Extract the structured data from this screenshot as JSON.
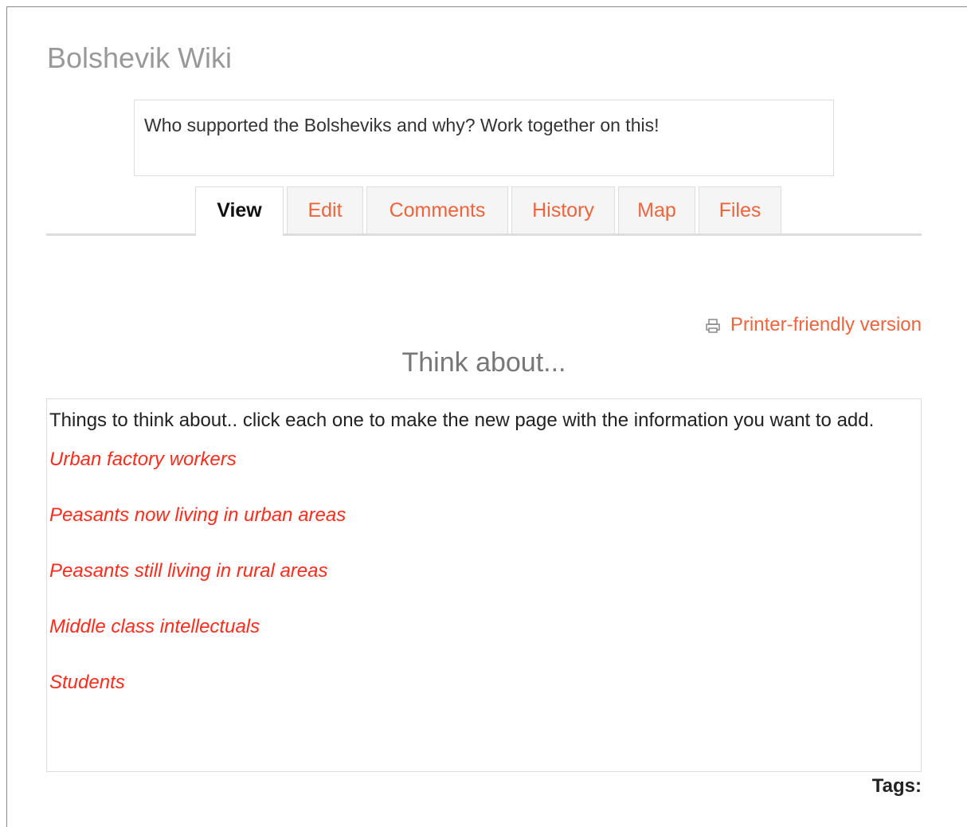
{
  "wiki": {
    "title": "Bolshevik Wiki",
    "intro": "Who supported the Bolsheviks and why? Work together on this!"
  },
  "tabs": [
    {
      "label": "View",
      "active": true
    },
    {
      "label": "Edit",
      "active": false
    },
    {
      "label": "Comments",
      "active": false
    },
    {
      "label": "History",
      "active": false
    },
    {
      "label": "Map",
      "active": false
    },
    {
      "label": "Files",
      "active": false
    }
  ],
  "actions": {
    "printer_label": "Printer-friendly version",
    "printer_icon": "printer-icon"
  },
  "page": {
    "heading": "Think about...",
    "intro_text": "Things to think about.. click each one to make the new page with the information you want to add.",
    "links": [
      "Urban factory workers",
      "Peasants now living in urban areas",
      "Peasants still living in rural areas",
      "Middle class intellectuals",
      "Students"
    ]
  },
  "footer": {
    "tags_label": "Tags:"
  },
  "colors": {
    "link": "#f0643c",
    "new_page_link": "#ff2a1a",
    "title": "#999999"
  }
}
